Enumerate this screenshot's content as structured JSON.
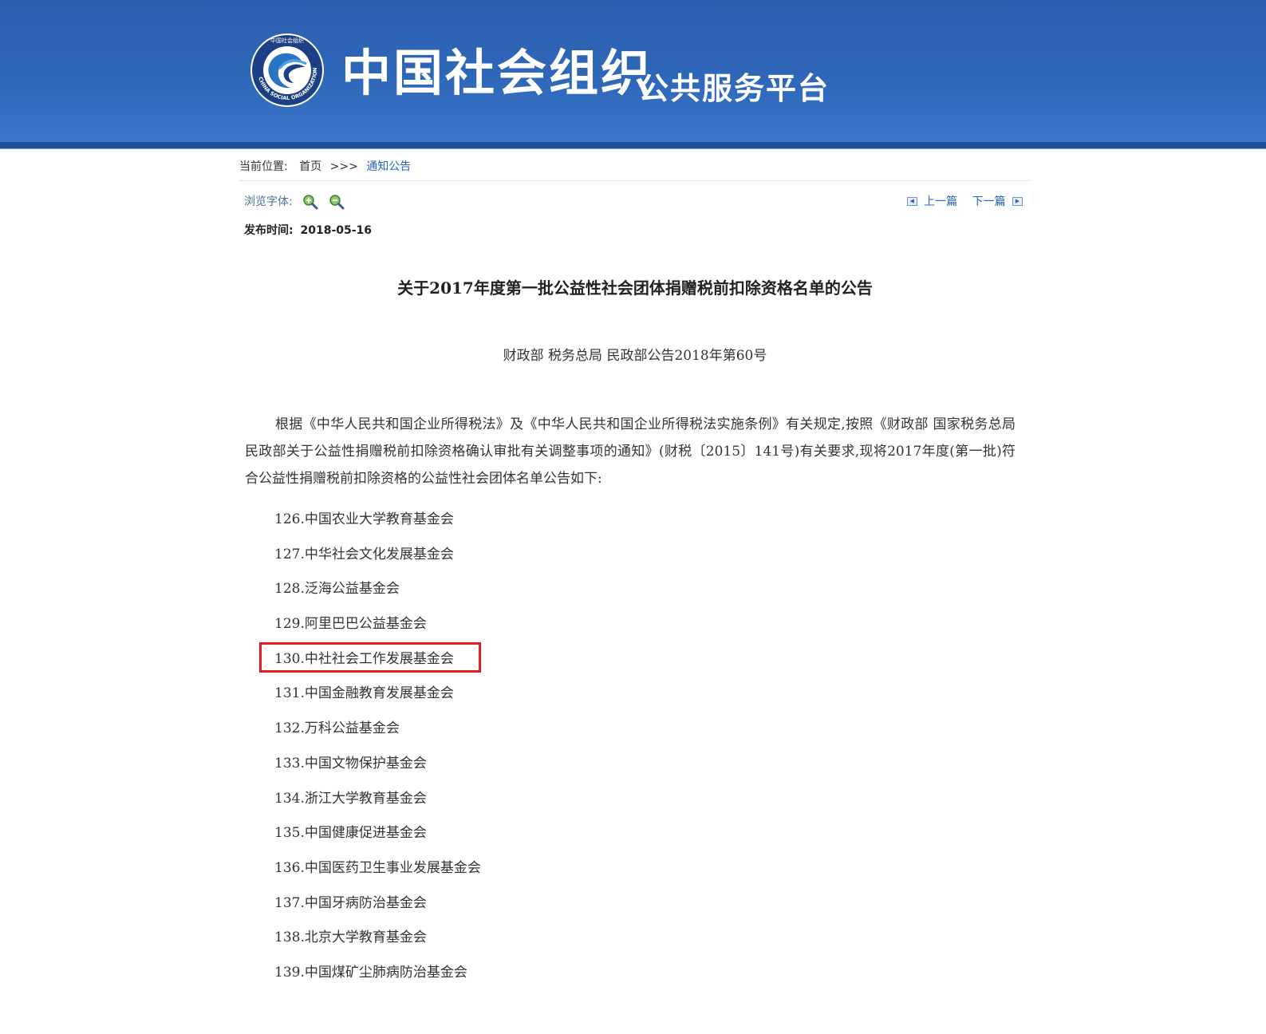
{
  "header": {
    "logo_arc_text": "中国社会组织",
    "logo_ring_text": "CHINA SOCIAL ORGANIZATION",
    "brand_main": "中国社会组织",
    "brand_sub": "公共服务平台",
    "colors": {
      "banner": "#2f67b8",
      "banner_dark": "#1f4f96"
    }
  },
  "breadcrumb": {
    "label": "当前位置:",
    "home": "首页",
    "separator": ">>>",
    "current": "通知公告"
  },
  "tools": {
    "font_label": "浏览字体:",
    "zoom_in_icon": "zoom-in-icon",
    "zoom_out_icon": "zoom-out-icon",
    "prev": "上一篇",
    "next": "下一篇"
  },
  "publish": {
    "label": "发布时间:",
    "date": "2018-05-16"
  },
  "article": {
    "title": "关于2017年度第一批公益性社会团体捐赠税前扣除资格名单的公告",
    "doc_number": "财政部 税务总局 民政部公告2018年第60号",
    "intro": "根据《中华人民共和国企业所得税法》及《中华人民共和国企业所得税法实施条例》有关规定,按照《财政部 国家税务总局 民政部关于公益性捐赠税前扣除资格确认审批有关调整事项的通知》(财税〔2015〕141号)有关要求,现将2017年度(第一批)符合公益性捐赠税前扣除资格的公益性社会团体名单公告如下:",
    "items": [
      "126.中国农业大学教育基金会",
      "127.中华社会文化发展基金会",
      "128.泛海公益基金会",
      "129.阿里巴巴公益基金会",
      "130.中社社会工作发展基金会",
      "131.中国金融教育发展基金会",
      "132.万科公益基金会",
      "133.中国文物保护基金会",
      "134.浙江大学教育基金会",
      "135.中国健康促进基金会",
      "136.中国医药卫生事业发展基金会",
      "137.中国牙病防治基金会",
      "138.北京大学教育基金会",
      "139.中国煤矿尘肺病防治基金会"
    ],
    "highlight_color": "#e21b1b"
  }
}
